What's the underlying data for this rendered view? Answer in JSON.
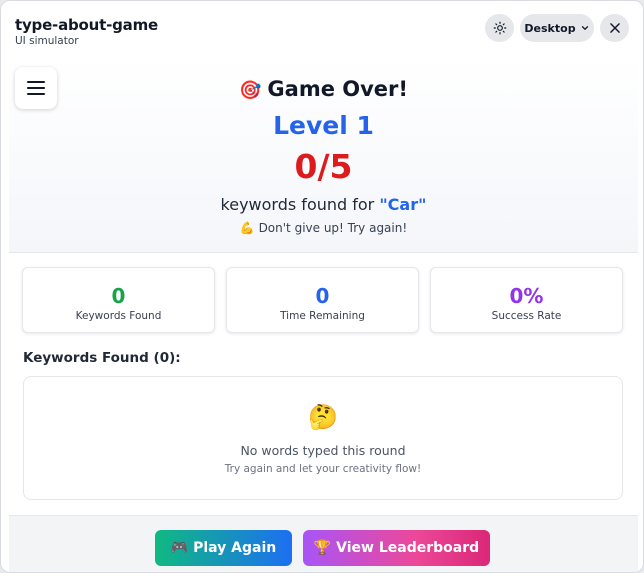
{
  "window": {
    "title": "type-about-game",
    "subtitle": "UI simulator",
    "device_label": "Desktop",
    "icons": [
      "sun-icon",
      "chevron-down-icon",
      "close-icon"
    ]
  },
  "game": {
    "heading_emoji": "🎯",
    "heading": "Game Over!",
    "level": "Level 1",
    "score": "0/5",
    "found_prefix": "keywords found for",
    "keyword": "\"Car\"",
    "encouragement": "💪 Don't give up! Try again!"
  },
  "stats": [
    {
      "value": "0",
      "label": "Keywords Found",
      "color": "#16a34a"
    },
    {
      "value": "0",
      "label": "Time Remaining",
      "color": "#2563eb"
    },
    {
      "value": "0%",
      "label": "Success Rate",
      "color": "#9333ea"
    }
  ],
  "keywords_section": {
    "title": "Keywords Found (0):",
    "empty_emoji": "🤔",
    "empty_main": "No words typed this round",
    "empty_sub": "Try again and let your creativity flow!"
  },
  "actions": {
    "play_again": "🎮 Play Again",
    "view_leaderboard": "🏆 View Leaderboard"
  },
  "colors": {
    "accent_blue": "#2563eb",
    "score_red": "#dc1c1c"
  }
}
